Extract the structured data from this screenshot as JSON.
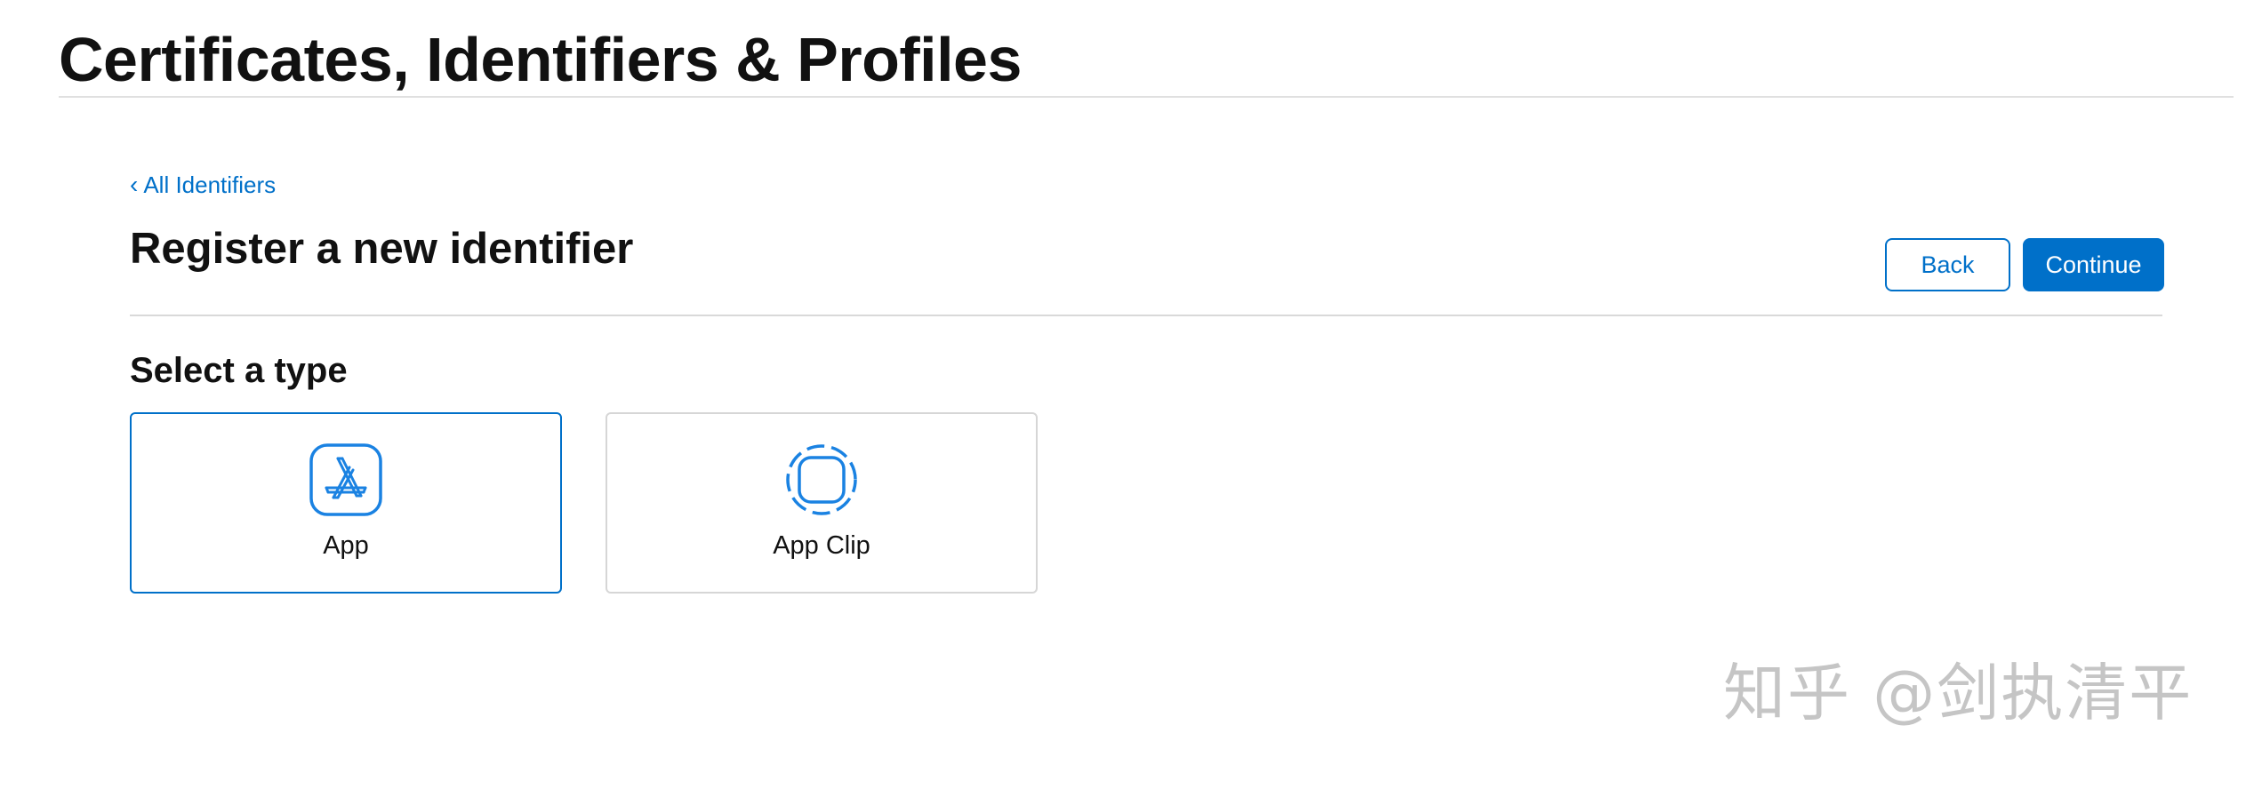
{
  "header": {
    "title": "Certificates, Identifiers & Profiles"
  },
  "breadcrumb": {
    "chevron": "‹",
    "label": "All Identifiers"
  },
  "page": {
    "title": "Register a new identifier"
  },
  "buttons": {
    "back_label": "Back",
    "continue_label": "Continue"
  },
  "type_section": {
    "title": "Select a type",
    "options": [
      {
        "label": "App",
        "icon": "app-store-icon",
        "selected": true
      },
      {
        "label": "App Clip",
        "icon": "app-clip-icon",
        "selected": false
      }
    ]
  },
  "watermark": {
    "text": "知乎 @剑执清平"
  },
  "colors": {
    "accent": "#0070c9",
    "icon_blue": "#1a82e2",
    "card_border": "#d6d6d6",
    "divider": "#d9d9d9"
  }
}
